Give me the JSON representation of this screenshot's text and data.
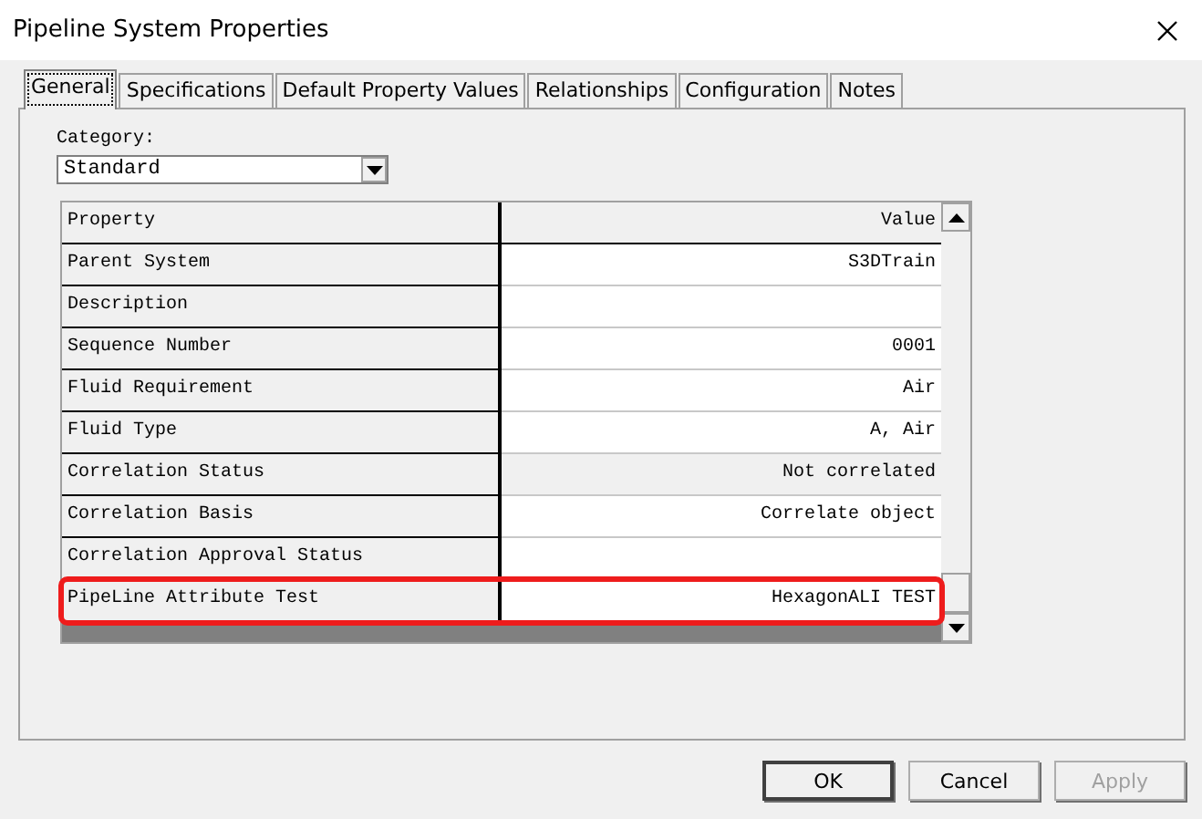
{
  "window": {
    "title": "Pipeline System Properties"
  },
  "tabs": [
    {
      "label": "General",
      "selected": true
    },
    {
      "label": "Specifications",
      "selected": false
    },
    {
      "label": "Default Property Values",
      "selected": false
    },
    {
      "label": "Relationships",
      "selected": false
    },
    {
      "label": "Configuration",
      "selected": false
    },
    {
      "label": "Notes",
      "selected": false
    }
  ],
  "category": {
    "label": "Category:",
    "value": "Standard"
  },
  "grid": {
    "columns": [
      "Property",
      "Value"
    ],
    "rows": [
      {
        "property": "Parent System",
        "value": "S3DTrain",
        "readonly": false,
        "highlighted": false
      },
      {
        "property": "Description",
        "value": "",
        "readonly": false,
        "highlighted": false
      },
      {
        "property": "Sequence Number",
        "value": "0001",
        "readonly": false,
        "highlighted": false
      },
      {
        "property": "Fluid Requirement",
        "value": "Air",
        "readonly": false,
        "highlighted": false
      },
      {
        "property": "Fluid Type",
        "value": "A, Air",
        "readonly": false,
        "highlighted": false
      },
      {
        "property": "Correlation Status",
        "value": "Not correlated",
        "readonly": true,
        "highlighted": false
      },
      {
        "property": "Correlation Basis",
        "value": "Correlate object",
        "readonly": false,
        "highlighted": false
      },
      {
        "property": "Correlation Approval Status",
        "value": "",
        "readonly": false,
        "highlighted": false
      },
      {
        "property": "PipeLine Attribute Test",
        "value": "HexagonALI TEST",
        "readonly": false,
        "highlighted": true
      }
    ]
  },
  "buttons": [
    {
      "label": "OK",
      "default": true,
      "disabled": false
    },
    {
      "label": "Cancel",
      "default": false,
      "disabled": false
    },
    {
      "label": "Apply",
      "default": false,
      "disabled": true
    }
  ]
}
